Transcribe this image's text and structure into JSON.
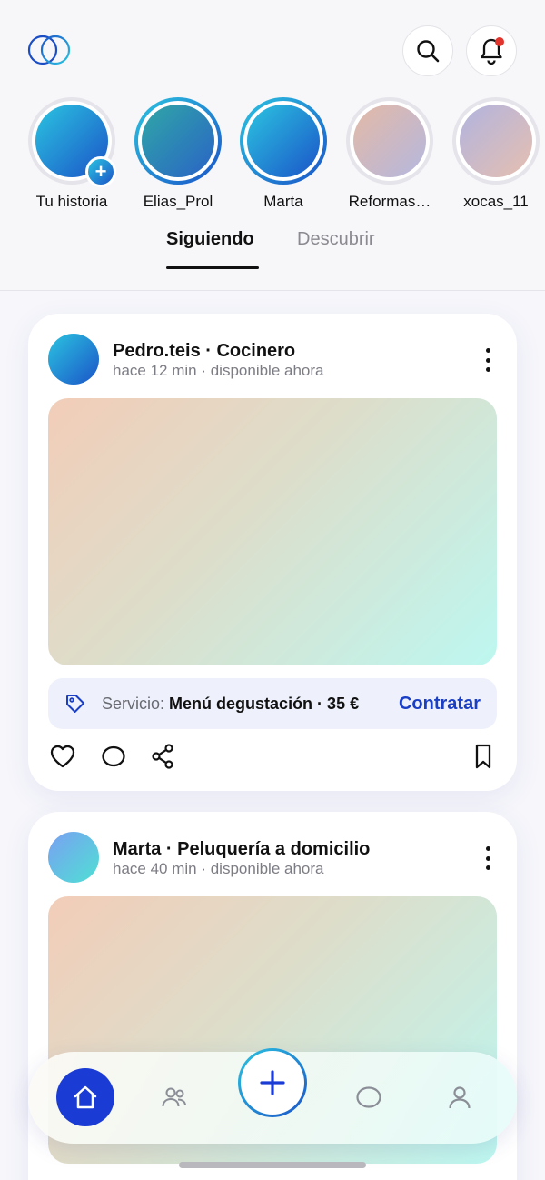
{
  "header": {
    "logo_icon": "logo-rings-icon",
    "search_icon": "search-icon",
    "notifications_icon": "bell-icon",
    "notification_dot_color": "#e0342c"
  },
  "stories": [
    {
      "name": "Tu historia",
      "state": "own",
      "add_badge": "+"
    },
    {
      "name": "Elias_Prol",
      "state": "active"
    },
    {
      "name": "Marta",
      "state": "active"
    },
    {
      "name": "Reformas…",
      "state": "seen"
    },
    {
      "name": "xocas_11",
      "state": "seen"
    }
  ],
  "tabs": [
    {
      "label": "Siguiendo",
      "active": true
    },
    {
      "label": "Descubrir",
      "active": false
    }
  ],
  "posts": [
    {
      "author": "Pedro.teis · Cocinero",
      "meta": "hace 12 min · disponible ahora",
      "service": {
        "prefix": "Servicio:",
        "name": "Menú degustación · 35 €",
        "cta": "Contratar"
      },
      "actions": [
        "heart-icon",
        "comment-icon",
        "share-icon",
        "bookmark-icon"
      ]
    },
    {
      "author": "Marta · Peluquería a domicilio",
      "meta": "hace 40 min · disponible ahora"
    }
  ],
  "bottom_nav": {
    "items": [
      "home-icon",
      "people-icon",
      "add-icon",
      "chat-icon",
      "profile-icon"
    ],
    "active": "home-icon"
  },
  "colors": {
    "accent": "#1b3cd4",
    "cta_text": "#1a3fc4",
    "gradient_start": "#2bc4e0",
    "gradient_end": "#1b54c8"
  }
}
